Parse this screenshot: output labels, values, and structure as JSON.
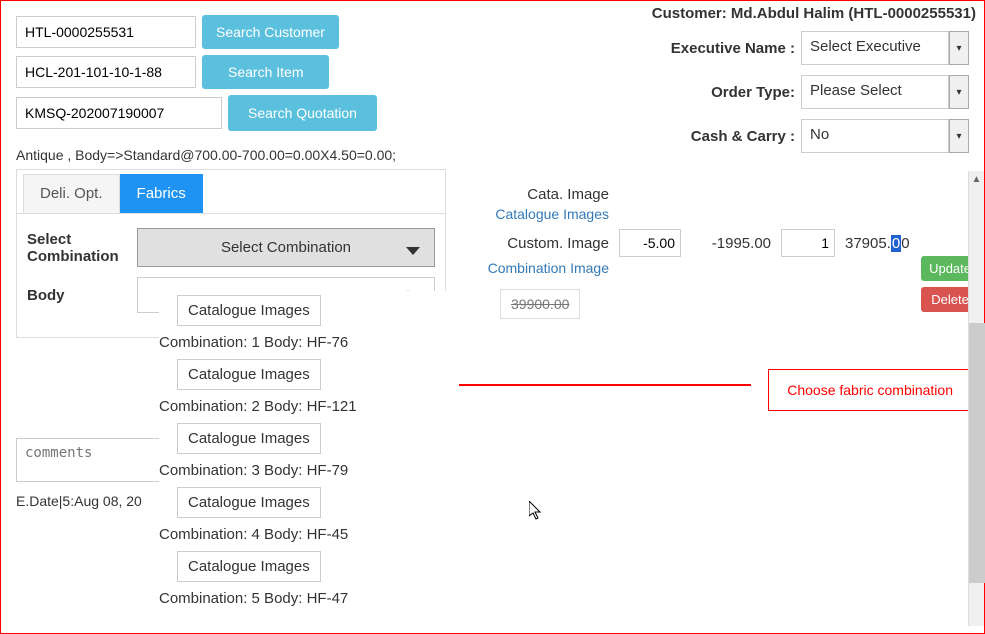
{
  "header": {
    "customer": "Customer: Md.Abdul Halim (HTL-0000255531)"
  },
  "search": {
    "customer_value": "HTL-0000255531",
    "customer_btn": "Search Customer",
    "item_value": "HCL-201-101-10-1-88",
    "item_btn": "Search Item",
    "quotation_value": "KMSQ-202007190007",
    "quotation_btn": "Search Quotation"
  },
  "right_form": {
    "exec_label": "Executive Name :",
    "exec_value": "Select Executive",
    "order_label": "Order Type:",
    "order_value": "Please Select",
    "cash_label": "Cash & Carry :",
    "cash_value": "No"
  },
  "summary": "Antique , Body=>Standard@700.00-700.00=0.00X4.50=0.00;",
  "tabs": {
    "deli": "Deli. Opt.",
    "fabrics": "Fabrics"
  },
  "fields": {
    "select_combo_label": "Select Combination",
    "select_combo_value": "Select Combination",
    "body_label": "Body"
  },
  "dropdown": [
    {
      "btn": "Catalogue Images"
    },
    {
      "label": "Combination: 1 Body: HF-76",
      "btn": "Catalogue Images"
    },
    {
      "label": "Combination: 2 Body: HF-121",
      "btn": "Catalogue Images"
    },
    {
      "label": "Combination: 3 Body: HF-79",
      "btn": "Catalogue Images"
    },
    {
      "label": "Combination: 4 Body: HF-45",
      "btn": "Catalogue Images"
    },
    {
      "label": "Combination: 5 Body: HF-47"
    }
  ],
  "right_panel": {
    "cata_label": "Cata. Image",
    "cata_link": "Catalogue Images",
    "custom_label": "Custom. Image",
    "custom_link": "Combination Image",
    "discount": "-5.00",
    "adjust": "-1995.00",
    "qty": "1",
    "price_pre": "37905.",
    "price_hl": "0",
    "price_post": "0",
    "strikeprice": "39900.00",
    "update": "Update",
    "delete": "Delete"
  },
  "annotation": "Choose fabric combination",
  "comments_placeholder": "comments",
  "edate": "E.Date|5:Aug 08, 20"
}
